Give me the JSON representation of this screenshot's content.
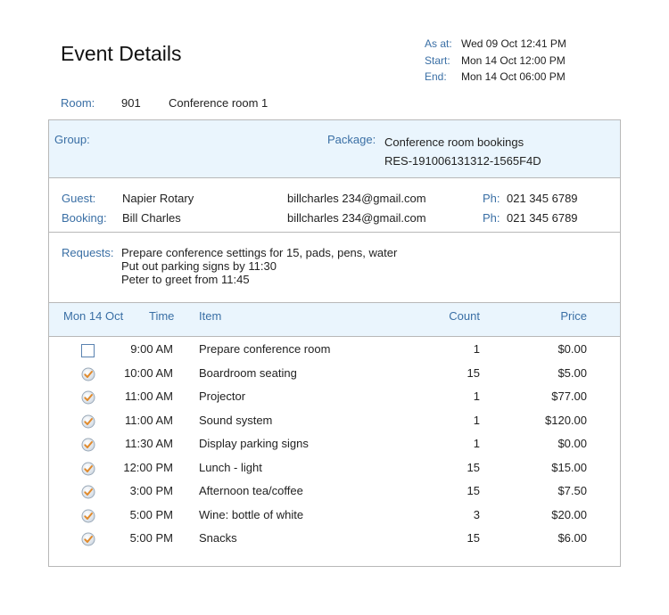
{
  "header": {
    "title": "Event Details",
    "as_at_label": "As at:",
    "as_at_value": "Wed 09 Oct 12:41 PM",
    "start_label": "Start:",
    "start_value": "Mon 14 Oct 12:00 PM",
    "end_label": "End:",
    "end_value": "Mon 14 Oct 06:00 PM"
  },
  "room": {
    "label": "Room:",
    "number": "901",
    "name": "Conference room 1"
  },
  "group": {
    "label": "Group:",
    "package_label": "Package:",
    "package_name": "Conference room bookings",
    "package_ref": "RES-191006131312-1565F4D"
  },
  "contacts": [
    {
      "label": "Guest:",
      "name": "Napier Rotary",
      "email": "billcharles 234@gmail.com",
      "ph_label": "Ph:",
      "phone": "021 345 6789"
    },
    {
      "label": "Booking:",
      "name": "Bill Charles",
      "email": "billcharles 234@gmail.com",
      "ph_label": "Ph:",
      "phone": "021 345 6789"
    }
  ],
  "requests": {
    "label": "Requests:",
    "lines": [
      "Prepare conference settings for 15, pads, pens, water",
      "Put out parking signs by 11:30",
      "Peter to greet from 11:45"
    ]
  },
  "table": {
    "headers": {
      "date": "Mon 14 Oct",
      "time": "Time",
      "item": "Item",
      "count": "Count",
      "price": "Price"
    },
    "rows": [
      {
        "done": false,
        "time": "9:00 AM",
        "item": "Prepare conference room",
        "count": "1",
        "price": "$0.00"
      },
      {
        "done": true,
        "time": "10:00 AM",
        "item": "Boardroom seating",
        "count": "15",
        "price": "$5.00"
      },
      {
        "done": true,
        "time": "11:00 AM",
        "item": "Projector",
        "count": "1",
        "price": "$77.00"
      },
      {
        "done": true,
        "time": "11:00 AM",
        "item": "Sound system",
        "count": "1",
        "price": "$120.00"
      },
      {
        "done": true,
        "time": "11:30 AM",
        "item": "Display parking signs",
        "count": "1",
        "price": "$0.00"
      },
      {
        "done": true,
        "time": "12:00 PM",
        "item": "Lunch - light",
        "count": "15",
        "price": "$15.00"
      },
      {
        "done": true,
        "time": "3:00 PM",
        "item": "Afternoon tea/coffee",
        "count": "15",
        "price": "$7.50"
      },
      {
        "done": true,
        "time": "5:00 PM",
        "item": "Wine: bottle of white",
        "count": "3",
        "price": "$20.00"
      },
      {
        "done": true,
        "time": "5:00 PM",
        "item": "Snacks",
        "count": "15",
        "price": "$6.00"
      }
    ]
  },
  "colors": {
    "label_blue": "#3a6fa5",
    "section_bg": "#eaf5fd",
    "border": "#b8b8b8"
  },
  "icons": {
    "done": "checked-circle-icon",
    "pending": "empty-checkbox-icon"
  }
}
